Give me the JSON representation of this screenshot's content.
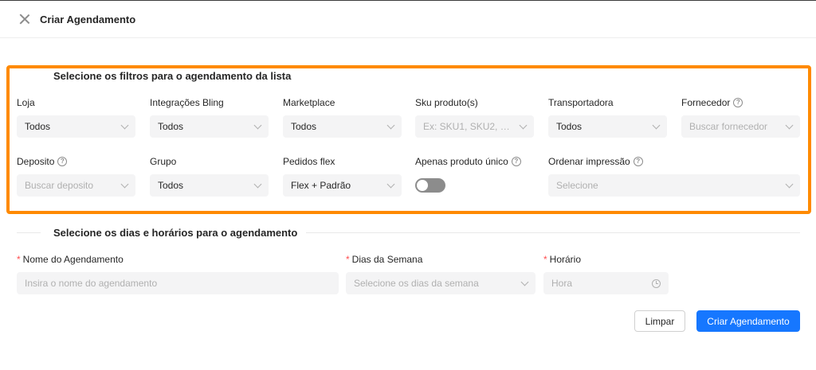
{
  "header": {
    "title": "Criar Agendamento"
  },
  "filters": {
    "section_title": "Selecione os filtros para o agendamento da lista",
    "loja": {
      "label": "Loja",
      "value": "Todos"
    },
    "integracoes": {
      "label": "Integrações Bling",
      "value": "Todos"
    },
    "marketplace": {
      "label": "Marketplace",
      "value": "Todos"
    },
    "sku": {
      "label": "Sku produto(s)",
      "placeholder": "Ex: SKU1, SKU2, SK..."
    },
    "transportadora": {
      "label": "Transportadora",
      "value": "Todos"
    },
    "fornecedor": {
      "label": "Fornecedor",
      "placeholder": "Buscar fornecedor"
    },
    "deposito": {
      "label": "Deposito",
      "placeholder": "Buscar deposito"
    },
    "grupo": {
      "label": "Grupo",
      "value": "Todos"
    },
    "pedidos_flex": {
      "label": "Pedidos flex",
      "value": "Flex + Padrão"
    },
    "produto_unico": {
      "label": "Apenas produto único",
      "enabled": false
    },
    "ordenar": {
      "label": "Ordenar impressão",
      "placeholder": "Selecione"
    }
  },
  "schedule": {
    "section_title": "Selecione os dias e horários para o agendamento",
    "nome": {
      "label": "Nome do Agendamento",
      "placeholder": "Insira o nome do agendamento"
    },
    "dias": {
      "label": "Dias da Semana",
      "placeholder": "Selecione os dias da semana"
    },
    "horario": {
      "label": "Horário",
      "placeholder": "Hora"
    }
  },
  "actions": {
    "clear": "Limpar",
    "submit": "Criar Agendamento"
  },
  "colors": {
    "highlight": "#ff8a00",
    "primary": "#1677ff",
    "required": "#ff4d4f"
  }
}
